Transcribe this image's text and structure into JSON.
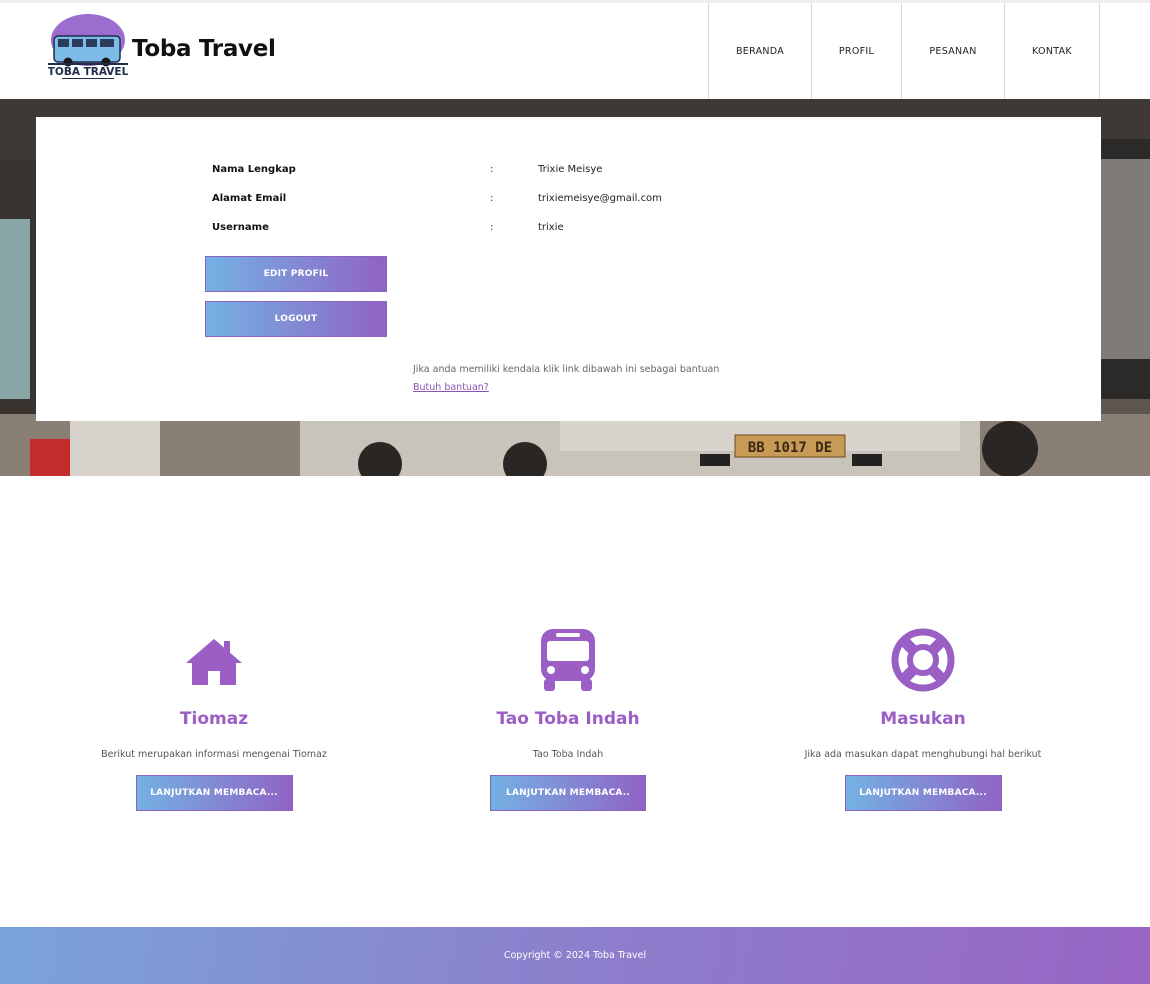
{
  "header": {
    "brand": "Toba Travel",
    "logo_text": "TOBA TRAVEL",
    "nav": [
      {
        "label": "BERANDA"
      },
      {
        "label": "PROFIL"
      },
      {
        "label": "PESANAN"
      },
      {
        "label": "KONTAK"
      }
    ]
  },
  "profile": {
    "rows": [
      {
        "label": "Nama Lengkap",
        "colon": ":",
        "value": "Trixie Meisye"
      },
      {
        "label": "Alamat Email",
        "colon": ":",
        "value": "trixiemeisye@gmail.com"
      },
      {
        "label": "Username",
        "colon": ":",
        "value": "trixie"
      }
    ],
    "edit_label": "EDIT PROFIL",
    "logout_label": "LOGOUT",
    "help_text": "Jika anda memiliki kendala klik link dibawah ini sebagai bantuan",
    "help_link": "Butuh bantuan?"
  },
  "hero": {
    "plate_text": "BB 1017 DE"
  },
  "features": [
    {
      "icon": "home-icon",
      "title": "Tiomaz",
      "text": "Berikut merupakan informasi mengenai Tiomaz",
      "button": "LANJUTKAN MEMBACA..."
    },
    {
      "icon": "bus-icon",
      "title": "Tao Toba Indah",
      "text": "Tao Toba Indah",
      "button": "LANJUTKAN MEMBACA.."
    },
    {
      "icon": "lifebuoy-icon",
      "title": "Masukan",
      "text": "Jika ada masukan dapat menghubungi hal berikut",
      "button": "LANJUTKAN MEMBACA..."
    }
  ],
  "footer": {
    "copyright": "Copyright © 2024 Toba Travel"
  },
  "colors": {
    "accent_purple": "#9b5ec4",
    "gradient_start": "#74b1e3",
    "gradient_end": "#9063c5"
  }
}
